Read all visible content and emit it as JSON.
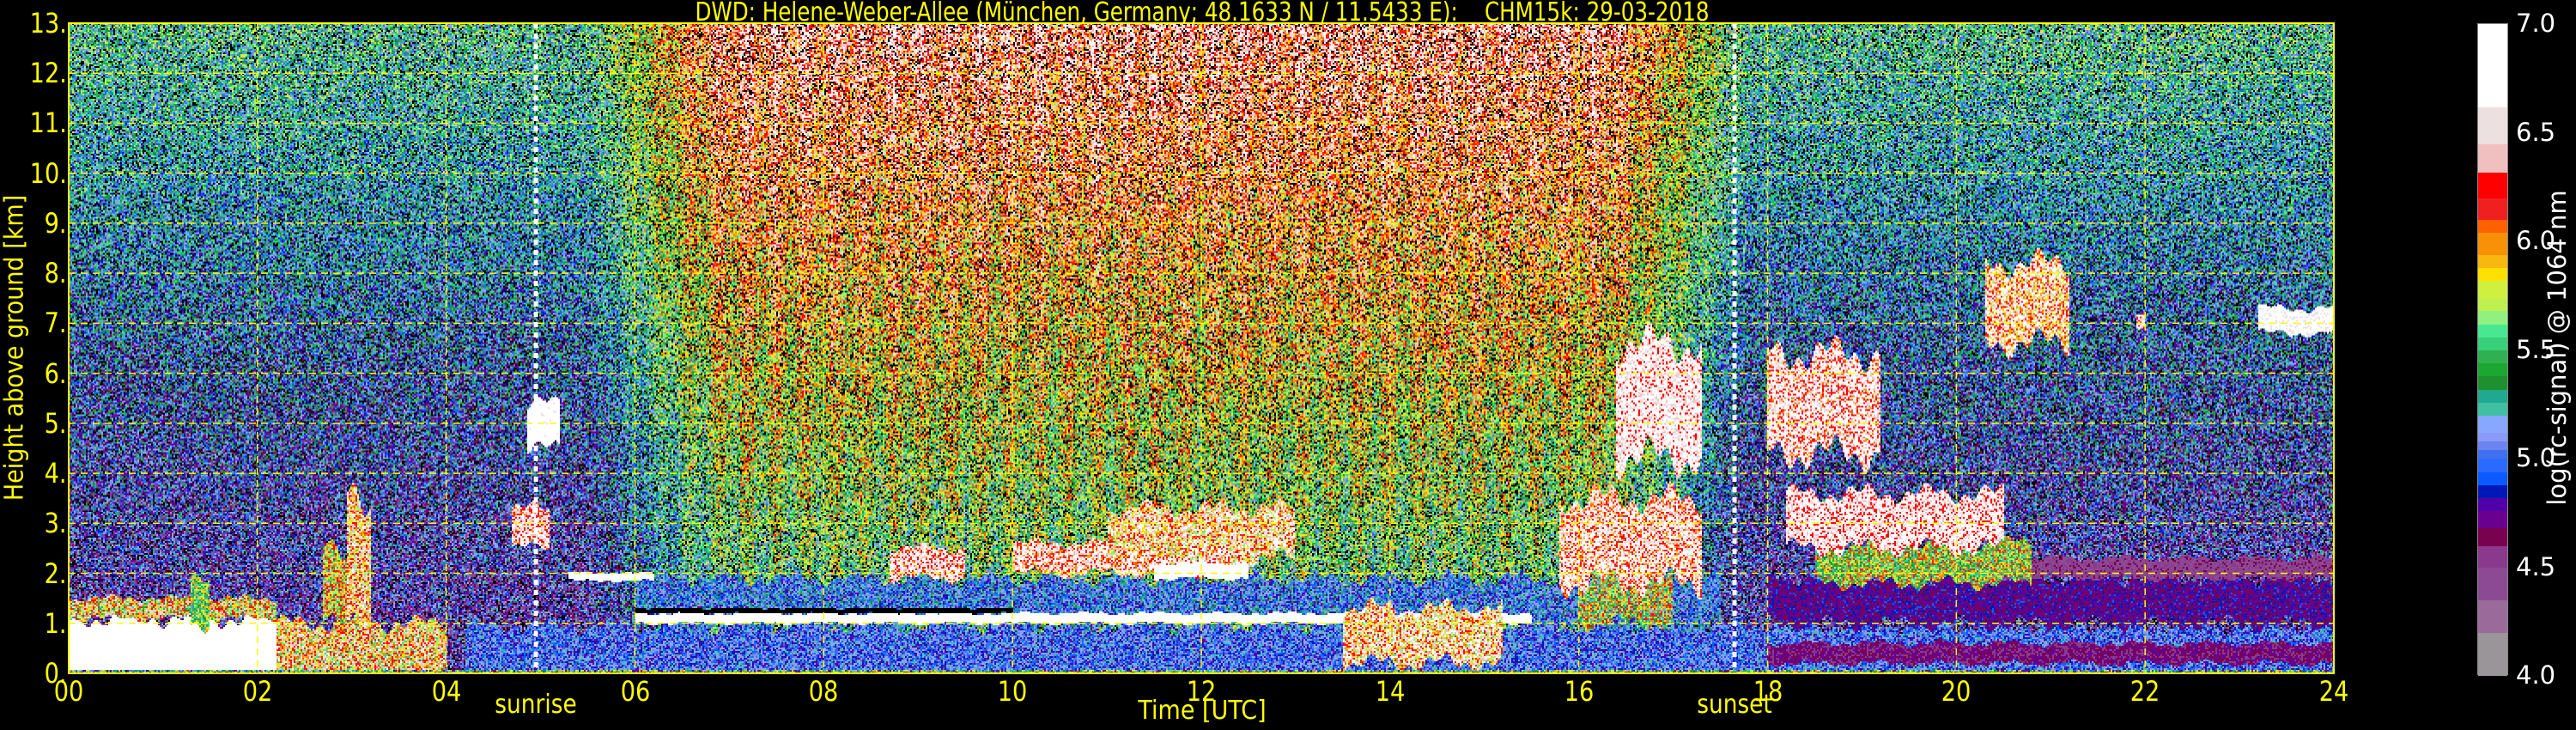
{
  "chart_data": {
    "type": "heatmap",
    "title": "DWD: Helene-Weber-Allee (München, Germany; 48.1633 N / 11.5433 E):    CHM15k: 29-03-2018",
    "xlabel": "Time [UTC]",
    "ylabel": "Height above ground [km]",
    "xlim": [
      0,
      24
    ],
    "ylim": [
      0,
      13
    ],
    "x_ticks": [
      0,
      2,
      4,
      6,
      8,
      10,
      12,
      14,
      16,
      18,
      20,
      22,
      24
    ],
    "x_tick_labels": [
      "00",
      "02",
      "04",
      "06",
      "08",
      "10",
      "12",
      "14",
      "16",
      "18",
      "20",
      "22",
      "24"
    ],
    "y_ticks": [
      0,
      1,
      2,
      3,
      4,
      5,
      6,
      7,
      8,
      9,
      10,
      11,
      12,
      13
    ],
    "y_tick_labels": [
      "0.",
      "1.",
      "2.",
      "3.",
      "4.",
      "5.",
      "6.",
      "7.",
      "8.",
      "9.",
      "10.",
      "11.",
      "12.",
      "13."
    ],
    "grid": true,
    "grid_color": "#ffff00",
    "events": [
      {
        "label": "sunrise",
        "time": 4.95
      },
      {
        "label": "sunset",
        "time": 17.65
      }
    ],
    "colorbar": {
      "label": "log(rc-signal) @ 1064 nm",
      "range": [
        4.0,
        7.0
      ],
      "ticks": [
        4.0,
        4.5,
        5.0,
        5.5,
        6.0,
        6.5,
        7.0
      ],
      "tick_labels": [
        "4.0",
        "4.5",
        "5.0",
        "5.5",
        "6.0",
        "6.5",
        "7.0"
      ],
      "stops": [
        {
          "from": 4.0,
          "color": "#9a9598"
        },
        {
          "from": 4.2,
          "color": "#9a6a9a"
        },
        {
          "from": 4.35,
          "color": "#8c4a94"
        },
        {
          "from": 4.5,
          "color": "#8a3a8c"
        },
        {
          "from": 4.6,
          "color": "#7a0050"
        },
        {
          "from": 4.68,
          "color": "#6a0090"
        },
        {
          "from": 4.76,
          "color": "#5000a8"
        },
        {
          "from": 4.82,
          "color": "#0018b8"
        },
        {
          "from": 4.88,
          "color": "#0a5aff"
        },
        {
          "from": 4.94,
          "color": "#2a6aff"
        },
        {
          "from": 5.0,
          "color": "#4070f0"
        },
        {
          "from": 5.04,
          "color": "#6c84f0"
        },
        {
          "from": 5.08,
          "color": "#8a9af8"
        },
        {
          "from": 5.12,
          "color": "#88a8ff"
        },
        {
          "from": 5.2,
          "color": "#40c0a0"
        },
        {
          "from": 5.26,
          "color": "#20a890"
        },
        {
          "from": 5.32,
          "color": "#1e9030"
        },
        {
          "from": 5.38,
          "color": "#1aa830"
        },
        {
          "from": 5.44,
          "color": "#30b050"
        },
        {
          "from": 5.5,
          "color": "#38d078"
        },
        {
          "from": 5.56,
          "color": "#48e890"
        },
        {
          "from": 5.62,
          "color": "#90f080"
        },
        {
          "from": 5.68,
          "color": "#c0f050"
        },
        {
          "from": 5.74,
          "color": "#d0f040"
        },
        {
          "from": 5.82,
          "color": "#ffe000"
        },
        {
          "from": 5.88,
          "color": "#f8b810"
        },
        {
          "from": 5.94,
          "color": "#f89008"
        },
        {
          "from": 6.04,
          "color": "#ff6000"
        },
        {
          "from": 6.1,
          "color": "#f02020"
        },
        {
          "from": 6.2,
          "color": "#ff0000"
        },
        {
          "from": 6.32,
          "color": "#f0c0c0"
        },
        {
          "from": 6.45,
          "color": "#ece0e0"
        },
        {
          "from": 6.62,
          "color": "#ffffff"
        }
      ]
    },
    "background": {
      "night_base": 4.75,
      "night_gradient_per_km": 0.05,
      "day_extra": 0.6,
      "day_gradient_per_km": 0.03,
      "noise": 0.45,
      "dropout_fraction": 0.15
    },
    "features": [
      {
        "name": "boundary layer aerosol",
        "t": [
          4.2,
          24
        ],
        "h": [
          0,
          0.95
        ],
        "v": 5.0,
        "spread": 0.25
      },
      {
        "name": "residual layer",
        "t": [
          6,
          17.5
        ],
        "h": [
          0.95,
          1.9
        ],
        "v": 5.05,
        "spread": 0.3
      },
      {
        "name": "night aerosol upper",
        "t": [
          18,
          24
        ],
        "h": [
          1.0,
          1.9
        ],
        "v": 4.75,
        "spread": 0.15
      },
      {
        "name": "night aerosol lower",
        "t": [
          18,
          24
        ],
        "h": [
          0.2,
          0.6
        ],
        "v": 4.65,
        "spread": 0.12
      },
      {
        "name": "night aerosol top",
        "t": [
          20,
          24
        ],
        "h": [
          1.9,
          2.3
        ],
        "v": 4.5,
        "spread": 0.15
      },
      {
        "name": "fog",
        "t": [
          0,
          2.2
        ],
        "h": [
          0,
          1.1
        ],
        "v": 6.9,
        "spread": 0.15
      },
      {
        "name": "fog top",
        "t": [
          0,
          2.2
        ],
        "h": [
          1.1,
          1.5
        ],
        "v": 6.0,
        "spread": 0.6
      },
      {
        "name": "low cloud",
        "t": [
          2.2,
          4.0
        ],
        "h": [
          0,
          1.0
        ],
        "v": 6.1,
        "spread": 0.6
      },
      {
        "name": "precip streak",
        "t": [
          2.95,
          3.2
        ],
        "h": [
          1.0,
          3.6
        ],
        "v": 6.2,
        "spread": 0.6
      },
      {
        "name": "precip streak",
        "t": [
          2.7,
          2.95
        ],
        "h": [
          1.0,
          2.5
        ],
        "v": 5.9,
        "spread": 0.5
      },
      {
        "name": "streak",
        "t": [
          1.3,
          1.5
        ],
        "h": [
          1.0,
          2.0
        ],
        "v": 5.6,
        "spread": 0.4
      },
      {
        "name": "mid cloud",
        "t": [
          4.85,
          5.2
        ],
        "h": [
          4.5,
          5.4
        ],
        "v": 6.9,
        "spread": 0.3
      },
      {
        "name": "mid cloud",
        "t": [
          4.7,
          5.1
        ],
        "h": [
          2.5,
          3.3
        ],
        "v": 6.5,
        "spread": 0.5
      },
      {
        "name": "thin cloud",
        "t": [
          5.3,
          6.2
        ],
        "h": [
          1.85,
          2.0
        ],
        "v": 6.9,
        "spread": 0.2
      },
      {
        "name": "cloud base",
        "t": [
          6.0,
          15.5
        ],
        "h": [
          1.0,
          1.2
        ],
        "v": 6.9,
        "spread": 0.2
      },
      {
        "name": "attenuated",
        "t": [
          6.0,
          10.0
        ],
        "h": [
          1.2,
          1.3
        ],
        "v": 3.0,
        "spread": 0
      },
      {
        "name": "cloud",
        "t": [
          8.7,
          9.5
        ],
        "h": [
          1.9,
          2.5
        ],
        "v": 6.5,
        "spread": 0.5
      },
      {
        "name": "cloud",
        "t": [
          10.0,
          12.5
        ],
        "h": [
          2.0,
          2.6
        ],
        "v": 6.5,
        "spread": 0.6
      },
      {
        "name": "cloud",
        "t": [
          11.0,
          13.0
        ],
        "h": [
          2.3,
          3.3
        ],
        "v": 6.3,
        "spread": 0.7
      },
      {
        "name": "cloud core",
        "t": [
          11.5,
          12.5
        ],
        "h": [
          1.9,
          2.2
        ],
        "v": 6.9,
        "spread": 0.2
      },
      {
        "name": "convective",
        "t": [
          13.5,
          15.2
        ],
        "h": [
          0.2,
          1.3
        ],
        "v": 6.3,
        "spread": 0.7
      },
      {
        "name": "cloud",
        "t": [
          16.0,
          17.0
        ],
        "h": [
          1.0,
          2.0
        ],
        "v": 5.7,
        "spread": 0.6
      },
      {
        "name": "cloud",
        "t": [
          15.8,
          17.3
        ],
        "h": [
          1.8,
          3.5
        ],
        "v": 6.5,
        "spread": 0.6
      },
      {
        "name": "mid cloud",
        "t": [
          16.4,
          17.3
        ],
        "h": [
          4.3,
          6.6
        ],
        "v": 6.7,
        "spread": 0.5
      },
      {
        "name": "mid cloud",
        "t": [
          18.0,
          19.2
        ],
        "h": [
          4.4,
          6.4
        ],
        "v": 6.6,
        "spread": 0.6
      },
      {
        "name": "cloud",
        "t": [
          18.5,
          20.8
        ],
        "h": [
          1.8,
          2.6
        ],
        "v": 5.7,
        "spread": 0.5
      },
      {
        "name": "cloud",
        "t": [
          18.2,
          20.5
        ],
        "h": [
          2.5,
          3.6
        ],
        "v": 6.6,
        "spread": 0.5
      },
      {
        "name": "high cloud",
        "t": [
          20.3,
          21.2
        ],
        "h": [
          6.6,
          8.2
        ],
        "v": 6.4,
        "spread": 0.7
      },
      {
        "name": "high cloud",
        "t": [
          21.9,
          22.0
        ],
        "h": [
          6.9,
          7.2
        ],
        "v": 6.5,
        "spread": 0.4
      },
      {
        "name": "high cloud",
        "t": [
          23.2,
          24.0
        ],
        "h": [
          6.8,
          7.3
        ],
        "v": 6.8,
        "spread": 0.3
      }
    ]
  }
}
